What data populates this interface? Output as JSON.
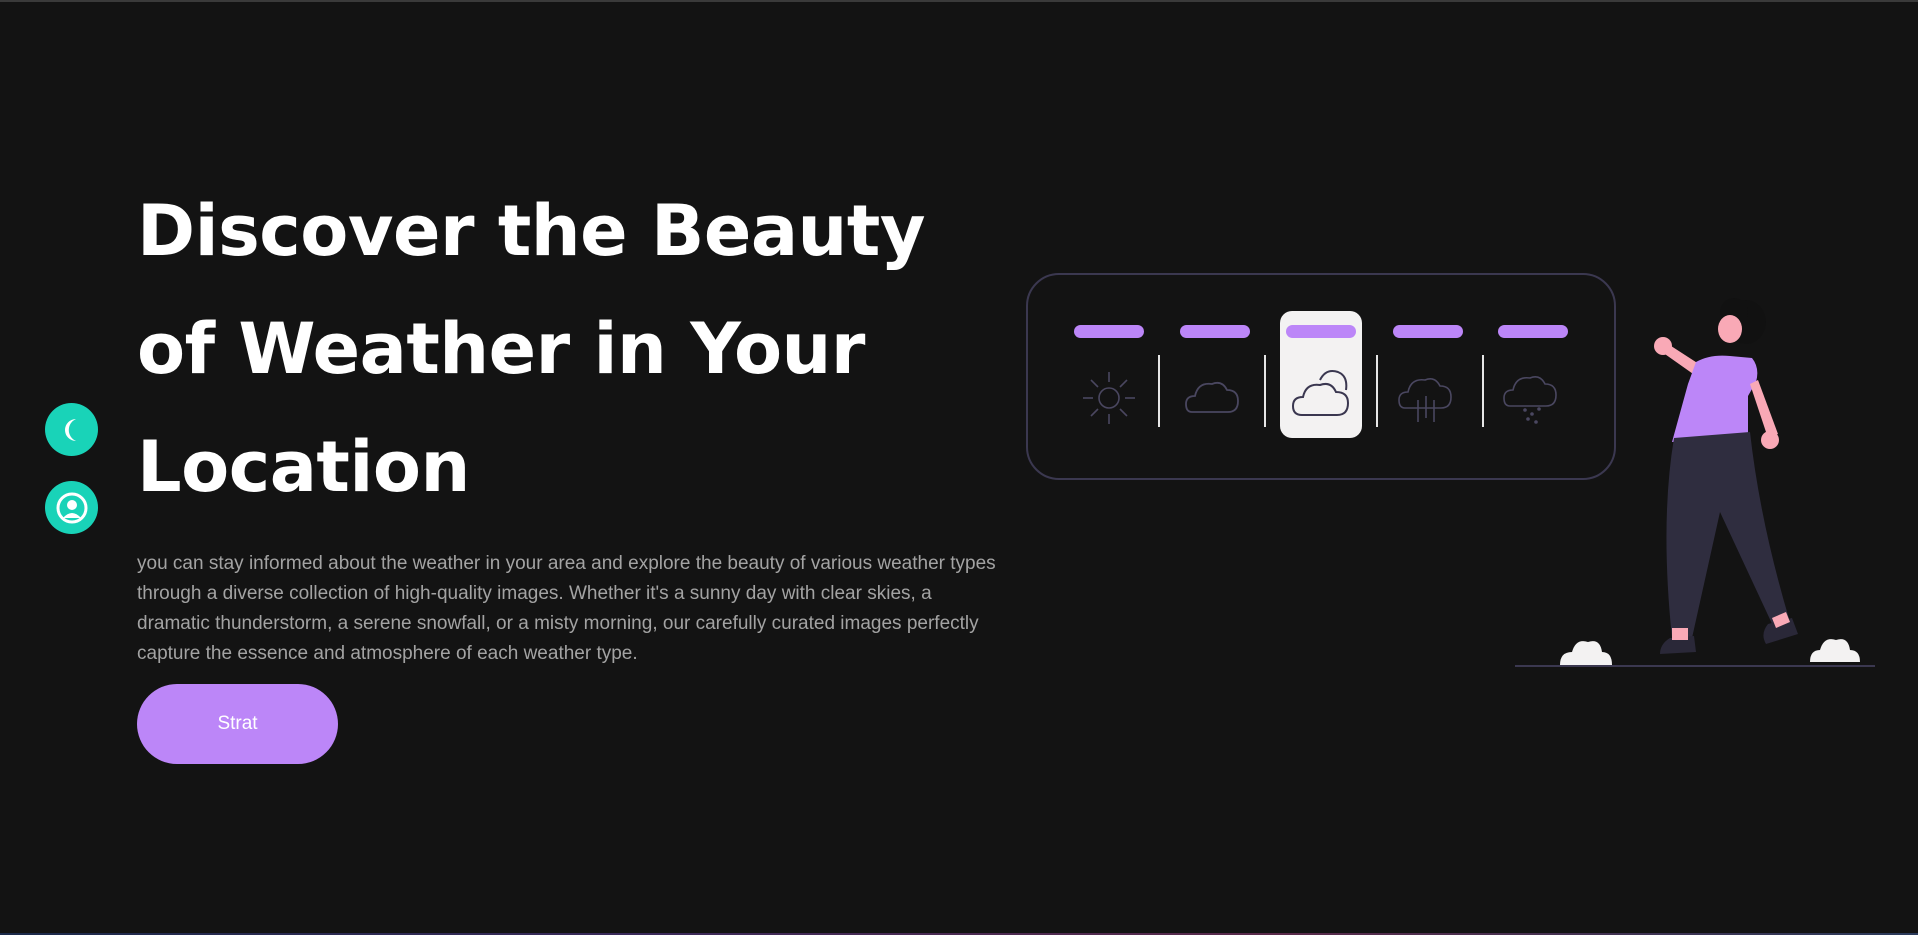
{
  "hero": {
    "title": "Discover the Beauty of Weather in Your Location",
    "description": "you can stay informed about the weather in your area and explore the beauty of various weather types through a diverse collection of high-quality images. Whether it's a sunny day with clear skies, a dramatic thunderstorm, a serene snowfall, or a misty morning, our carefully curated images perfectly capture the essence and atmosphere of each weather type.",
    "cta_label": "Strat"
  },
  "sidebar": {
    "theme_icon": "moon-icon",
    "profile_icon": "user-circle-icon"
  },
  "illustration": {
    "weather_cards": [
      {
        "icon": "sun-icon",
        "selected": false
      },
      {
        "icon": "cloud-icon",
        "selected": false
      },
      {
        "icon": "partly-cloudy-icon",
        "selected": true
      },
      {
        "icon": "rain-icon",
        "selected": false
      },
      {
        "icon": "snow-icon",
        "selected": false
      }
    ]
  },
  "colors": {
    "background": "#131313",
    "accent": "#bc86f8",
    "teal": "#19d3b8",
    "text": "#ffffff",
    "muted_text": "#a3a3a3"
  }
}
